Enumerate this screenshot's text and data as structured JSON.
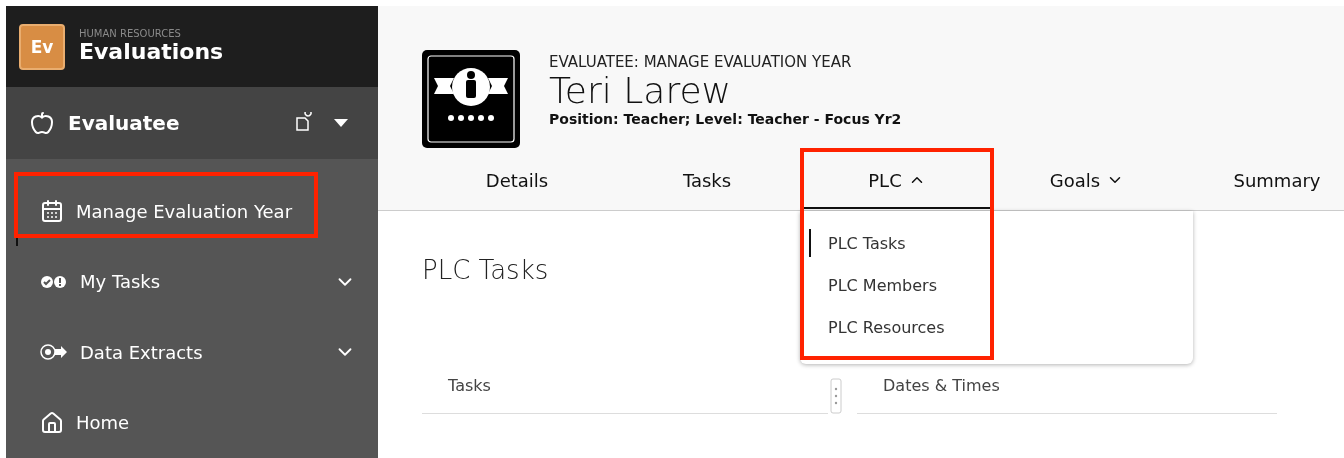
{
  "app": {
    "logo": "Ev",
    "category": "HUMAN RESOURCES",
    "title": "Evaluations"
  },
  "role": {
    "label": "Evaluatee",
    "expanded": false
  },
  "sidebar": {
    "items": [
      {
        "kind": "calendar",
        "label": "Manage Evaluation Year",
        "selected": true,
        "highlighted": true
      },
      {
        "kind": "tasks",
        "label": "My Tasks",
        "selected": false,
        "expanded": false
      },
      {
        "kind": "extracts",
        "label": "Data Extracts",
        "selected": false,
        "expanded": false
      },
      {
        "kind": "home",
        "label": "Home",
        "selected": false
      }
    ]
  },
  "header": {
    "eyebrow": "EVALUATEE: MANAGE EVALUATION YEAR",
    "name": "Teri Larew",
    "subtitle": "Position: Teacher; Level: Teacher - Focus Yr2"
  },
  "tabs": [
    {
      "label": "Details",
      "selected": false
    },
    {
      "label": "Tasks",
      "selected": false
    },
    {
      "label": "PLC",
      "selected": true,
      "expanded": true,
      "highlighted": true,
      "menu": [
        {
          "label": "PLC Tasks",
          "selected": true
        },
        {
          "label": "PLC Members",
          "selected": false
        },
        {
          "label": "PLC Resources",
          "selected": false
        }
      ]
    },
    {
      "label": "Goals",
      "selected": false,
      "expanded": false
    },
    {
      "label": "Summary",
      "selected": false
    }
  ],
  "section": {
    "title": "PLC Tasks"
  },
  "table": {
    "columns": [
      "Tasks",
      "Dates & Times"
    ]
  }
}
